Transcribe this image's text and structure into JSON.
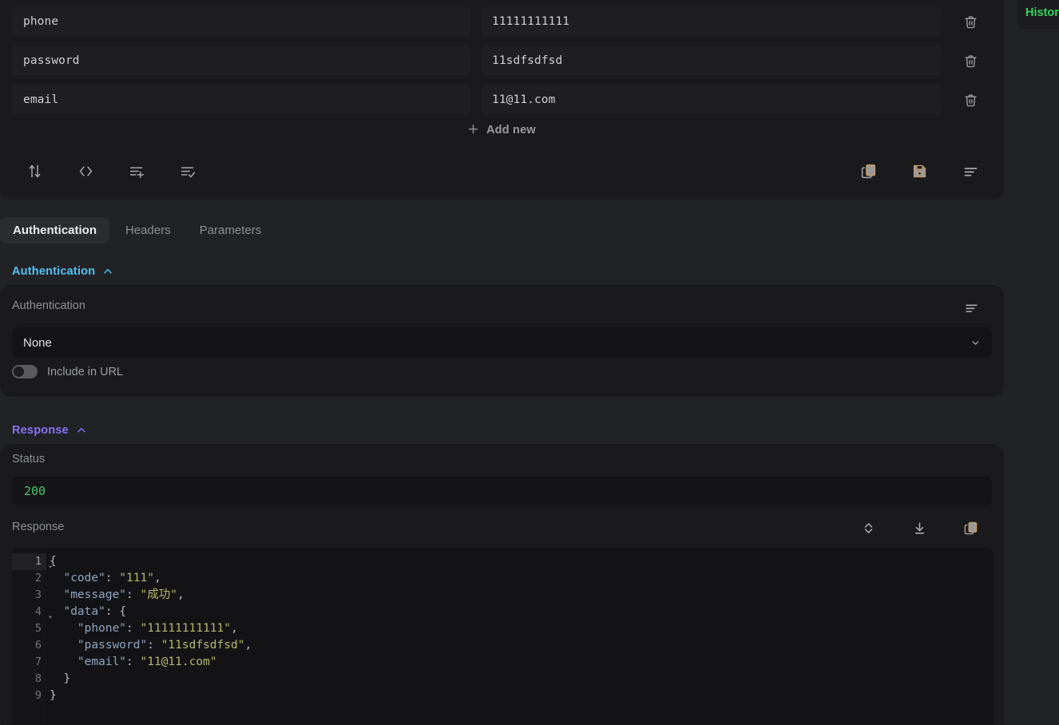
{
  "history": {
    "label": "History"
  },
  "kv_table": {
    "add_new_label": "Add new",
    "rows": [
      {
        "key": "phone",
        "value": "11111111111"
      },
      {
        "key": "password",
        "value": "11sdfsdfsd"
      },
      {
        "key": "email",
        "value": "11@11.com"
      }
    ],
    "toolbar_left": [
      {
        "name": "sort-icon"
      },
      {
        "name": "code-icon"
      },
      {
        "name": "add-list-icon"
      },
      {
        "name": "check-list-icon"
      }
    ],
    "toolbar_right": [
      {
        "name": "copy-icon"
      },
      {
        "name": "save-icon"
      },
      {
        "name": "format-icon"
      }
    ]
  },
  "tabs": [
    {
      "label": "Authentication",
      "active": true
    },
    {
      "label": "Headers",
      "active": false
    },
    {
      "label": "Parameters",
      "active": false
    }
  ],
  "auth_section": {
    "header": "Authentication",
    "field_label": "Authentication",
    "selected": "None",
    "toggle_label": "Include in URL",
    "toggle_on": false
  },
  "response_section": {
    "header": "Response",
    "status_label": "Status",
    "status_value": "200",
    "response_label": "Response",
    "code": {
      "lines": [
        {
          "n": "1",
          "fold": true,
          "text": "{"
        },
        {
          "n": "2",
          "fold": false,
          "text": "  \"code\": \"111\","
        },
        {
          "n": "3",
          "fold": false,
          "text": "  \"message\": \"成功\","
        },
        {
          "n": "4",
          "fold": true,
          "text": "  \"data\": {"
        },
        {
          "n": "5",
          "fold": false,
          "text": "    \"phone\": \"11111111111\","
        },
        {
          "n": "6",
          "fold": false,
          "text": "    \"password\": \"11sdfsdfsd\","
        },
        {
          "n": "7",
          "fold": false,
          "text": "    \"email\": \"11@11.com\""
        },
        {
          "n": "8",
          "fold": false,
          "text": "  }"
        },
        {
          "n": "9",
          "fold": false,
          "text": "}"
        }
      ]
    }
  },
  "colors": {
    "page_bg": "#212226",
    "panel_bg": "#1a1a1c",
    "auth_accent": "#4fc3f7",
    "response_accent": "#8b6ff5",
    "status_ok": "#4ec26a",
    "history_accent": "#33d35e"
  }
}
